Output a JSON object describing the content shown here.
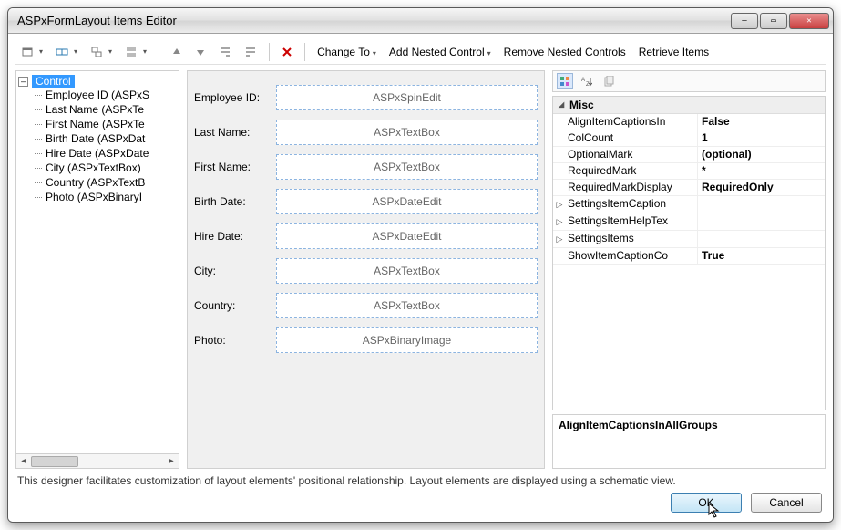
{
  "window": {
    "title": "ASPxFormLayout Items Editor"
  },
  "toolbar": {
    "change_to": "Change To",
    "add_nested": "Add Nested Control",
    "remove_nested": "Remove Nested Controls",
    "retrieve": "Retrieve Items"
  },
  "tree": {
    "root": "Control",
    "items": [
      "Employee ID (ASPxS",
      "Last Name (ASPxTe",
      "First Name (ASPxTe",
      "Birth Date (ASPxDat",
      "Hire Date (ASPxDate",
      "City (ASPxTextBox)",
      "Country (ASPxTextB",
      "Photo (ASPxBinaryI"
    ]
  },
  "form_rows": [
    {
      "label": "Employee ID:",
      "control": "ASPxSpinEdit"
    },
    {
      "label": "Last Name:",
      "control": "ASPxTextBox"
    },
    {
      "label": "First Name:",
      "control": "ASPxTextBox"
    },
    {
      "label": "Birth Date:",
      "control": "ASPxDateEdit"
    },
    {
      "label": "Hire Date:",
      "control": "ASPxDateEdit"
    },
    {
      "label": "City:",
      "control": "ASPxTextBox"
    },
    {
      "label": "Country:",
      "control": "ASPxTextBox"
    },
    {
      "label": "Photo:",
      "control": "ASPxBinaryImage"
    }
  ],
  "propgrid": {
    "category": "Misc",
    "rows": [
      {
        "exp": "",
        "key": "AlignItemCaptionsIn",
        "val": "False",
        "bold": true
      },
      {
        "exp": "",
        "key": "ColCount",
        "val": "1",
        "bold": true
      },
      {
        "exp": "",
        "key": "OptionalMark",
        "val": "(optional)",
        "bold": true
      },
      {
        "exp": "",
        "key": "RequiredMark",
        "val": "*",
        "bold": true
      },
      {
        "exp": "",
        "key": "RequiredMarkDisplay",
        "val": "RequiredOnly",
        "bold": true
      },
      {
        "exp": "▷",
        "key": "SettingsItemCaption",
        "val": "",
        "bold": false
      },
      {
        "exp": "▷",
        "key": "SettingsItemHelpTex",
        "val": "",
        "bold": false
      },
      {
        "exp": "▷",
        "key": "SettingsItems",
        "val": "",
        "bold": false
      },
      {
        "exp": "",
        "key": "ShowItemCaptionCo",
        "val": "True",
        "bold": true
      }
    ],
    "description": "AlignItemCaptionsInAllGroups"
  },
  "footer": {
    "text": "This designer facilitates customization of layout elements' positional relationship. Layout elements are displayed using a schematic view.",
    "ok": "OK",
    "cancel": "Cancel"
  }
}
